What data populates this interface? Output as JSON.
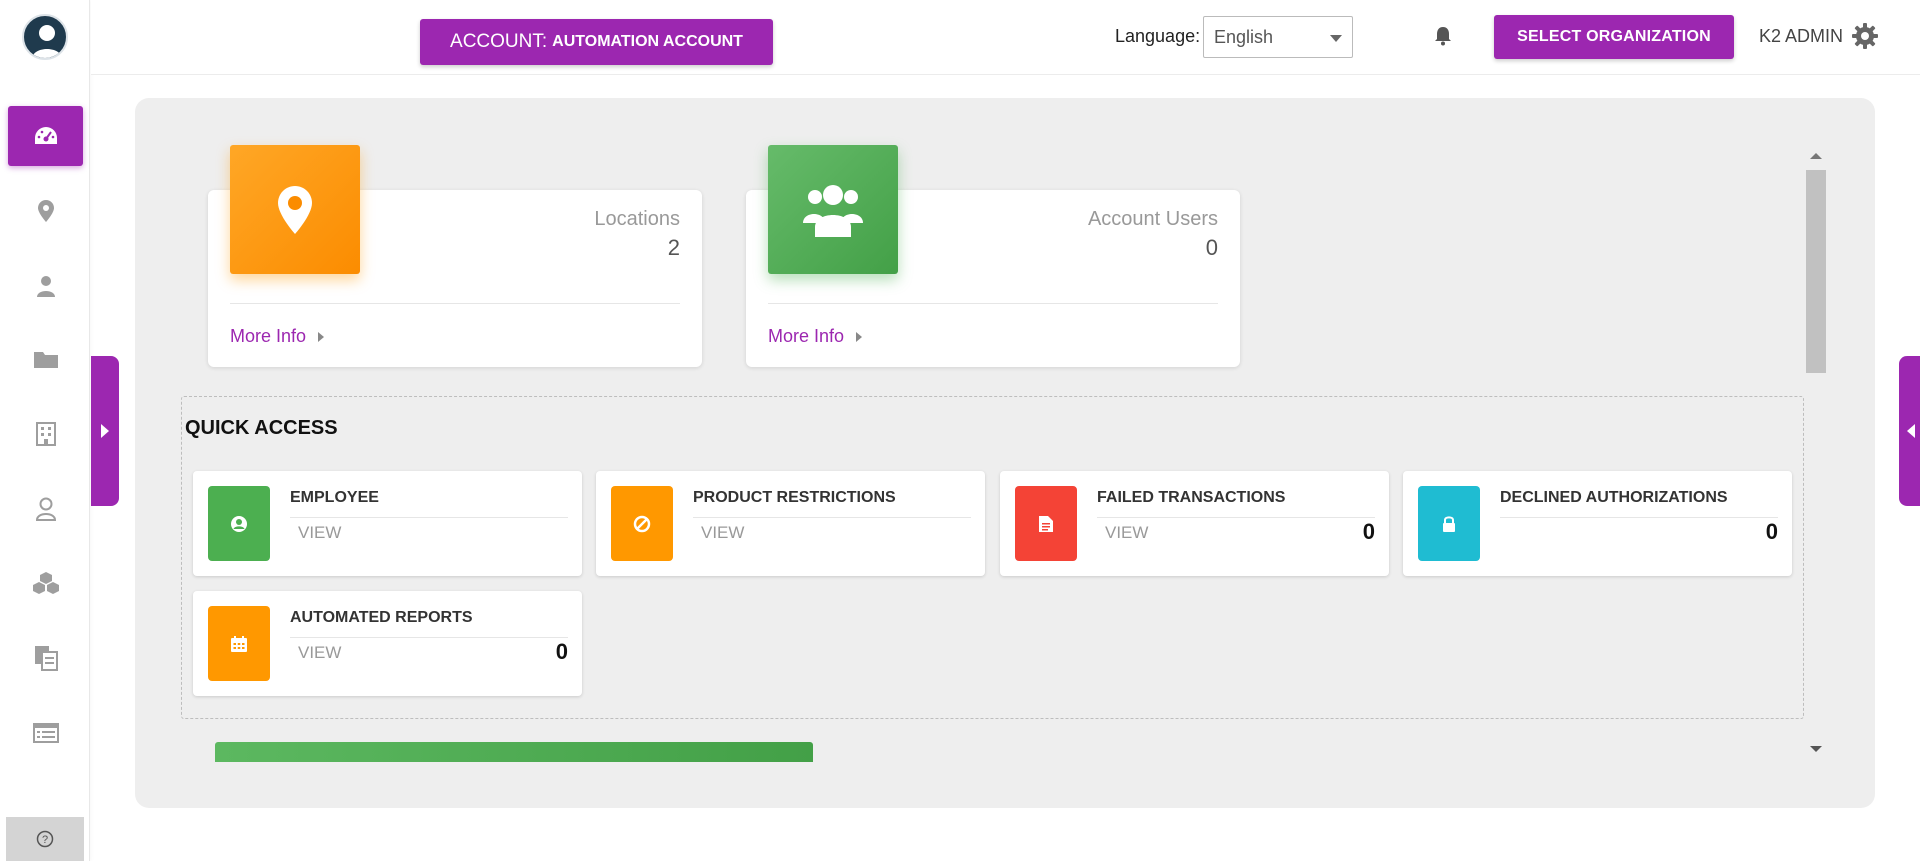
{
  "header": {
    "account_prefix": "ACCOUNT:",
    "account_name": "AUTOMATION ACCOUNT",
    "language_label": "Language:",
    "language_value": "English",
    "select_org_label": "SELECT ORGANIZATION",
    "user_name": "K2 ADMIN"
  },
  "sidebar": {
    "items": [
      {
        "icon": "dashboard-icon",
        "active": true
      },
      {
        "icon": "location-pin-icon"
      },
      {
        "icon": "user-icon"
      },
      {
        "icon": "folder-icon"
      },
      {
        "icon": "building-icon"
      },
      {
        "icon": "user-outline-icon"
      },
      {
        "icon": "cubes-icon"
      },
      {
        "icon": "documents-icon"
      },
      {
        "icon": "list-icon"
      }
    ],
    "help_icon": "question-circle-icon"
  },
  "stats": [
    {
      "title": "Locations",
      "value": "2",
      "more_info": "More Info",
      "icon": "map-marker-icon",
      "color": "#fb8c00"
    },
    {
      "title": "Account Users",
      "value": "0",
      "more_info": "More Info",
      "icon": "users-icon",
      "color": "#43a047"
    }
  ],
  "quick_access": {
    "title": "QUICK ACCESS",
    "items": [
      {
        "title": "EMPLOYEE",
        "view": "VIEW",
        "count": "",
        "icon": "user-circle-icon",
        "color": "#4caf50"
      },
      {
        "title": "PRODUCT RESTRICTIONS",
        "view": "VIEW",
        "count": "",
        "icon": "ban-icon",
        "color": "#ff9800"
      },
      {
        "title": "FAILED TRANSACTIONS",
        "view": "VIEW",
        "count": "0",
        "icon": "document-icon",
        "color": "#f44336"
      },
      {
        "title": "DECLINED AUTHORIZATIONS",
        "view": "",
        "count": "0",
        "icon": "lock-icon",
        "color": "#1fbcd2"
      },
      {
        "title": "AUTOMATED REPORTS",
        "view": "VIEW",
        "count": "0",
        "icon": "calendar-icon",
        "color": "#ff9800"
      }
    ]
  },
  "colors": {
    "accent": "#9c27b0",
    "panel_bg": "#eeeeee"
  }
}
